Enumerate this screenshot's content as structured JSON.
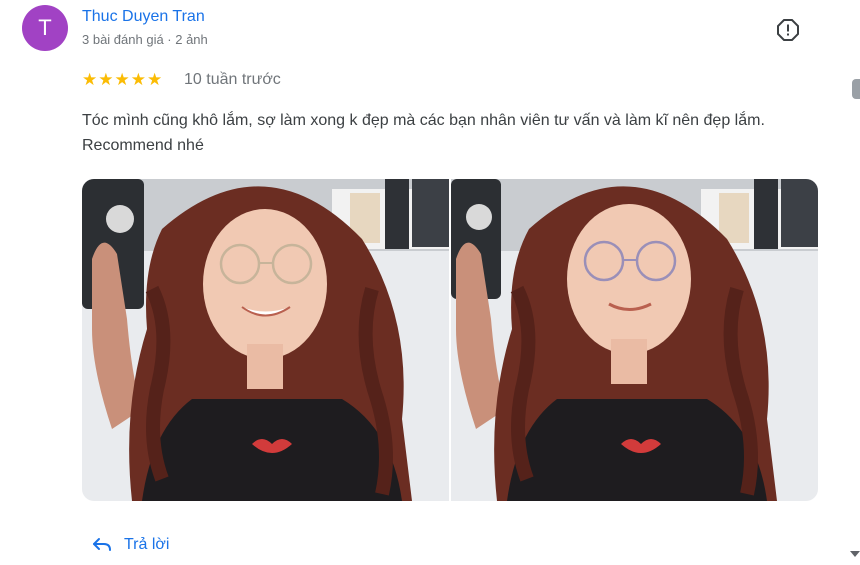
{
  "review": {
    "avatar_letter": "T",
    "author_name": "Thuc Duyen Tran",
    "author_meta": "3 bài đánh giá · 2 ảnh",
    "rating": 5,
    "time": "10 tuần trước",
    "text": "Tóc mình cũng khô lắm, sợ làm xong k đẹp mà các bạn nhân viên tư vấn và làm kĩ nên đẹp lắm. Recommend nhé",
    "photos_count": 2,
    "reply_label": "Trả lời"
  },
  "colors": {
    "avatar": "#a142c4",
    "link": "#1a73e8",
    "star": "#fbbc04",
    "meta": "#70757a"
  },
  "icons": {
    "report": "report-flag-icon",
    "reply": "reply-arrow-icon",
    "star": "star-icon"
  }
}
